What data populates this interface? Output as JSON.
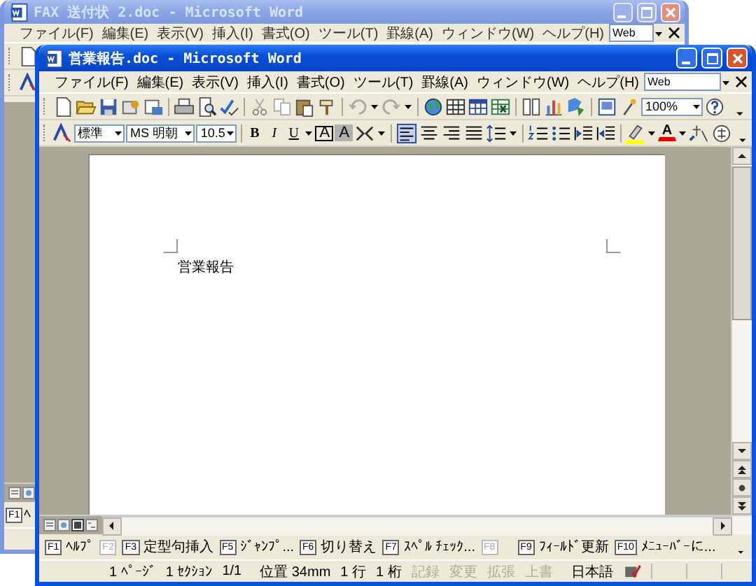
{
  "windows": [
    {
      "title": "FAX 送付状 2.doc - Microsoft Word",
      "active": false,
      "menu": [
        "ファイル(F)",
        "編集(E)",
        "表示(V)",
        "挿入(I)",
        "書式(O)",
        "ツール(T)",
        "罫線(A)",
        "ウィンドウ(W)",
        "ヘルプ(H)"
      ],
      "help_box": "Web",
      "function_keys": [
        {
          "key": "F1",
          "label": "ﾍ",
          "disabled": false
        }
      ]
    },
    {
      "title": "営業報告.doc - Microsoft Word",
      "active": true,
      "menu": [
        "ファイル(F)",
        "編集(E)",
        "表示(V)",
        "挿入(I)",
        "書式(O)",
        "ツール(T)",
        "罫線(A)",
        "ウィンドウ(W)",
        "ヘルプ(H)"
      ],
      "help_box": "Web",
      "zoom": "100%",
      "style": "標準",
      "font": "MS 明朝",
      "font_size": "10.5",
      "text_buttons": [
        {
          "kind": "bold",
          "label": "B"
        },
        {
          "kind": "italic",
          "label": "I"
        },
        {
          "kind": "underline",
          "label": "U"
        },
        {
          "kind": "border",
          "label": "A"
        },
        {
          "kind": "shading",
          "label": "A"
        }
      ],
      "font_color_button": {
        "label": "A"
      },
      "document": {
        "text": "営業報告"
      },
      "function_keys": [
        {
          "key": "F1",
          "label": "ﾍﾙﾌﾟ",
          "disabled": false
        },
        {
          "key": "F2",
          "disabled": true
        },
        {
          "key": "F3",
          "label": "定型句挿入",
          "disabled": false
        },
        {
          "key": "F5",
          "label": "ｼﾞｬﾝﾌﾟ...",
          "disabled": false
        },
        {
          "key": "F6",
          "label": "切り替え",
          "disabled": false
        },
        {
          "key": "F7",
          "label": "ｽﾍﾟﾙ ﾁｪｯｸ...",
          "disabled": false
        },
        {
          "key": "F8",
          "disabled": true
        },
        {
          "key": "F9",
          "label": "ﾌｨｰﾙﾄﾞ更新",
          "disabled": false
        },
        {
          "key": "F10",
          "label": "ﾒﾆｭｰﾊﾞｰに...",
          "disabled": false
        }
      ],
      "status_bar": [
        {
          "text": "1 ﾍﾟｰｼﾞ",
          "disabled": false
        },
        {
          "text": "1 ｾｸｼｮﾝ",
          "disabled": false
        },
        {
          "text": "1/1",
          "disabled": false
        },
        {
          "text": "位置 34mm",
          "disabled": false
        },
        {
          "text": "1 行",
          "disabled": false
        },
        {
          "text": "1 桁",
          "disabled": false
        },
        {
          "text": "記録",
          "disabled": true
        },
        {
          "text": "変更",
          "disabled": true
        },
        {
          "text": "拡張",
          "disabled": true
        },
        {
          "text": "上書",
          "disabled": true
        },
        {
          "text": "日本語",
          "disabled": false
        }
      ]
    }
  ]
}
